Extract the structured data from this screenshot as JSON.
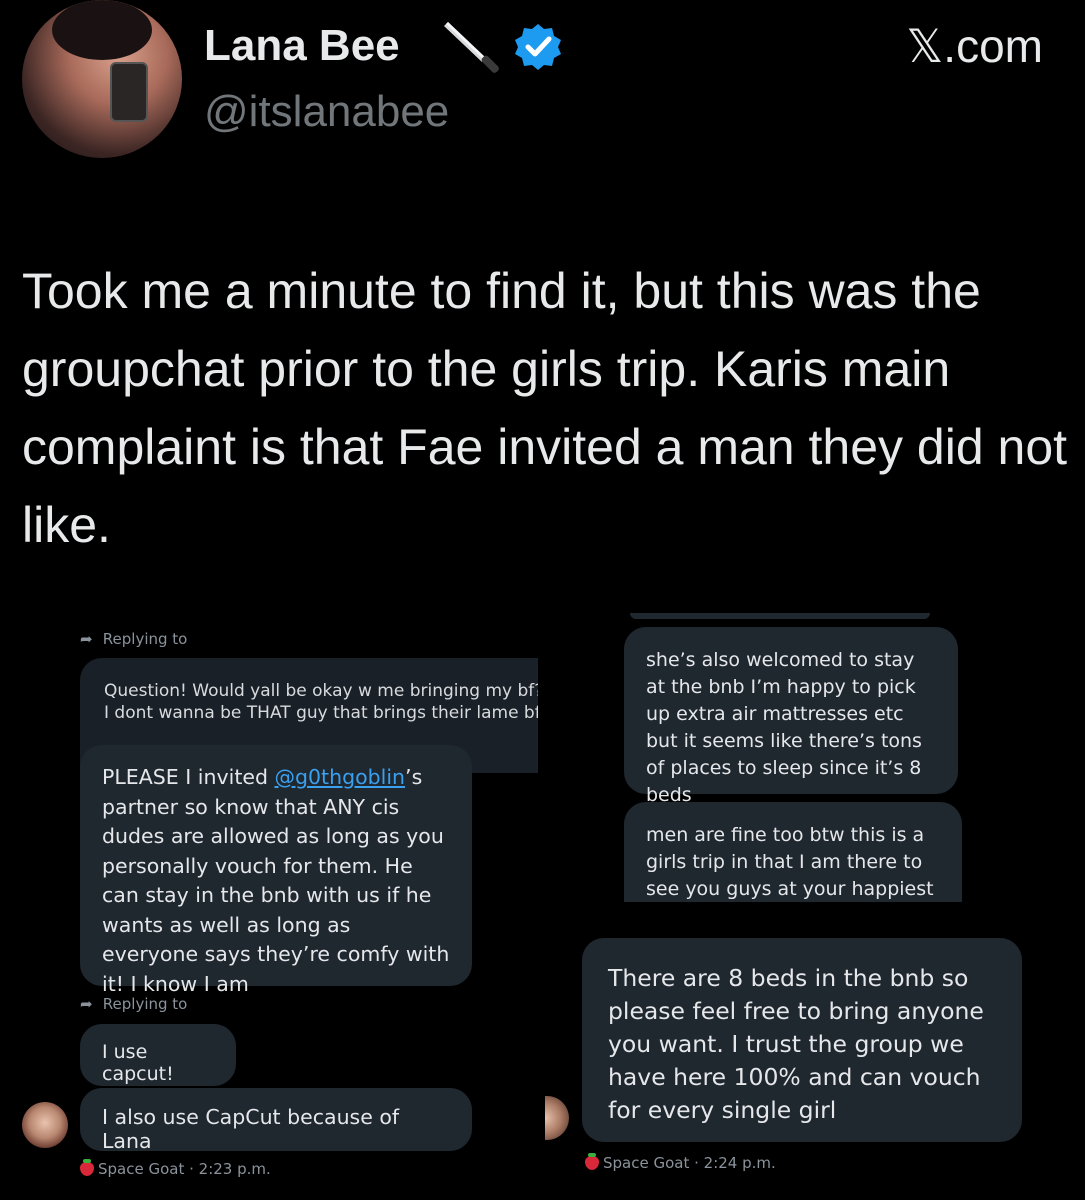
{
  "header": {
    "display_name": "Lana Bee",
    "handle": "@itslanabee",
    "site": "𝕏.com",
    "icons": [
      "knife-icon",
      "verified-badge-icon"
    ],
    "verified_color": "#1d9bf0"
  },
  "tweet": {
    "text": "Took me a minute to find it, but this was the groupchat prior to the girls trip. Karis main complaint is that Fae invited a man they did not like."
  },
  "left_chat": {
    "reply_label_1": "Replying to",
    "quoted_line_1": "Question! Would yall be okay w me bringing my bf?",
    "quoted_line_2": "I dont wanna be THAT guy that brings their lame bf",
    "bubble_1_prefix": "PLEASE I invited ",
    "bubble_1_mention": "@g0thgoblin",
    "bubble_1_suffix": "’s partner so know that ANY cis dudes are allowed as long as you personally vouch for them. He can stay in the bnb with us if he wants as well as long as everyone says they’re comfy with it! I know I am",
    "reply_label_2": "Replying to",
    "bubble_2": "I use capcut!",
    "bubble_3": "I also use CapCut because of Lana",
    "meta": "Space Goat · 2:23 p.m."
  },
  "right_chat": {
    "bubble_1": "she’s also welcomed to stay at the bnb I’m happy to pick up extra air mattresses etc but it seems like there’s tons of places to sleep since it’s 8 beds",
    "bubble_2": "men are fine too btw this is a girls trip in that I am there to see you guys at your happiest with",
    "bubble_3": "There are 8 beds in the bnb so please feel free to bring anyone you want. I trust the group we have here 100% and can vouch for every single girl",
    "meta": "Space Goat · 2:24 p.m."
  },
  "colors": {
    "background": "#000000",
    "bubble": "#1f272f",
    "mention": "#3aa0f0",
    "muted": "#71767b"
  }
}
